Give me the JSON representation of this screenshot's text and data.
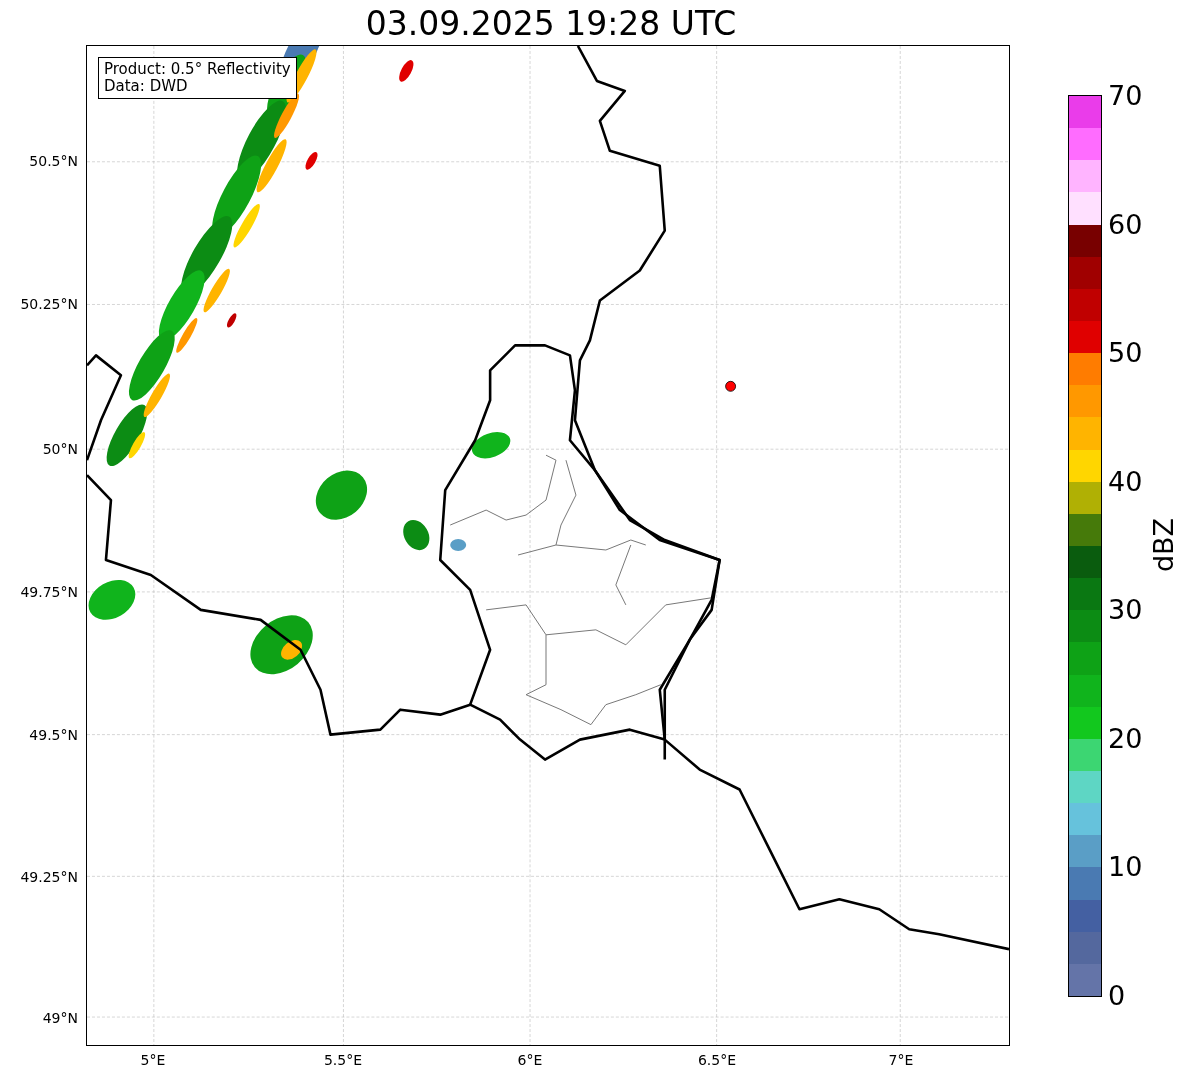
{
  "title": "03.09.2025 19:28 UTC",
  "info_box": [
    "Product: 0.5° Reflectivity",
    "Data: DWD"
  ],
  "y_ticks": [
    "50.5°N",
    "50.25°N",
    "50°N",
    "49.75°N",
    "49.5°N",
    "49.25°N",
    "49°N"
  ],
  "x_ticks": [
    "5°E",
    "5.5°E",
    "6°E",
    "6.5°E",
    "7°E"
  ],
  "colorbar": {
    "label": "dBZ",
    "ticks": [
      "70",
      "60",
      "50",
      "40",
      "30",
      "20",
      "10",
      "0"
    ],
    "bins": [
      {
        "color": "#6474a8"
      },
      {
        "color": "#54689e"
      },
      {
        "color": "#4460a2"
      },
      {
        "color": "#4a7ab2"
      },
      {
        "color": "#5a9ec6"
      },
      {
        "color": "#66c2dc"
      },
      {
        "color": "#5ed6c4"
      },
      {
        "color": "#3cd672"
      },
      {
        "color": "#12c81e"
      },
      {
        "color": "#10b41c"
      },
      {
        "color": "#0ea216"
      },
      {
        "color": "#0c8c14"
      },
      {
        "color": "#0a7812"
      },
      {
        "color": "#0a5c0e"
      },
      {
        "color": "#467a0a"
      },
      {
        "color": "#b0b004"
      },
      {
        "color": "#ffd600"
      },
      {
        "color": "#ffb400"
      },
      {
        "color": "#ff9800"
      },
      {
        "color": "#ff7c00"
      },
      {
        "color": "#e00000"
      },
      {
        "color": "#c00000"
      },
      {
        "color": "#a00000"
      },
      {
        "color": "#780000"
      },
      {
        "color": "#ffe0ff"
      },
      {
        "color": "#ffb4ff"
      },
      {
        "color": "#ff6cff"
      },
      {
        "color": "#ea3cea"
      }
    ]
  }
}
